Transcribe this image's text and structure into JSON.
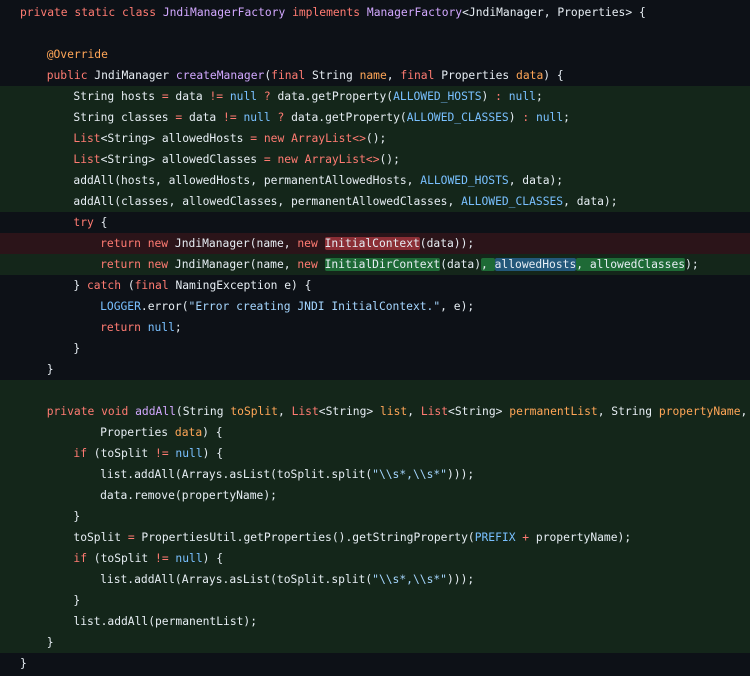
{
  "code": {
    "lines": [
      {
        "indent": 0,
        "bg": "",
        "tokens": [
          {
            "t": "private static class ",
            "c": "kw"
          },
          {
            "t": "JndiManagerFactory ",
            "c": "fn"
          },
          {
            "t": "implements ",
            "c": "kw"
          },
          {
            "t": "ManagerFactory",
            "c": "fn"
          },
          {
            "t": "<JndiManager, Properties> {",
            "c": "id"
          }
        ]
      },
      {
        "indent": 0,
        "bg": "",
        "tokens": []
      },
      {
        "indent": 1,
        "bg": "",
        "tokens": [
          {
            "t": "@Override",
            "c": "ann"
          }
        ]
      },
      {
        "indent": 1,
        "bg": "",
        "tokens": [
          {
            "t": "public ",
            "c": "kw"
          },
          {
            "t": "JndiManager ",
            "c": "id"
          },
          {
            "t": "createManager",
            "c": "fn"
          },
          {
            "t": "(",
            "c": "id"
          },
          {
            "t": "final ",
            "c": "kw"
          },
          {
            "t": "String ",
            "c": "id"
          },
          {
            "t": "name",
            "c": "var"
          },
          {
            "t": ", ",
            "c": "id"
          },
          {
            "t": "final ",
            "c": "kw"
          },
          {
            "t": "Properties ",
            "c": "id"
          },
          {
            "t": "data",
            "c": "var"
          },
          {
            "t": ") {",
            "c": "id"
          }
        ]
      },
      {
        "indent": 2,
        "bg": "add",
        "tokens": [
          {
            "t": "String hosts ",
            "c": "id"
          },
          {
            "t": "= ",
            "c": "kw"
          },
          {
            "t": "data ",
            "c": "id"
          },
          {
            "t": "!= ",
            "c": "kw"
          },
          {
            "t": "null ",
            "c": "const"
          },
          {
            "t": "? ",
            "c": "kw"
          },
          {
            "t": "data.getProperty(",
            "c": "id"
          },
          {
            "t": "ALLOWED_HOSTS",
            "c": "const"
          },
          {
            "t": ") ",
            "c": "id"
          },
          {
            "t": ": ",
            "c": "kw"
          },
          {
            "t": "null",
            "c": "const"
          },
          {
            "t": ";",
            "c": "id"
          }
        ]
      },
      {
        "indent": 2,
        "bg": "add",
        "tokens": [
          {
            "t": "String classes ",
            "c": "id"
          },
          {
            "t": "= ",
            "c": "kw"
          },
          {
            "t": "data ",
            "c": "id"
          },
          {
            "t": "!= ",
            "c": "kw"
          },
          {
            "t": "null ",
            "c": "const"
          },
          {
            "t": "? ",
            "c": "kw"
          },
          {
            "t": "data.getProperty(",
            "c": "id"
          },
          {
            "t": "ALLOWED_CLASSES",
            "c": "const"
          },
          {
            "t": ") ",
            "c": "id"
          },
          {
            "t": ": ",
            "c": "kw"
          },
          {
            "t": "null",
            "c": "const"
          },
          {
            "t": ";",
            "c": "id"
          }
        ]
      },
      {
        "indent": 2,
        "bg": "add",
        "tokens": [
          {
            "t": "List",
            "c": "kw"
          },
          {
            "t": "<String> ",
            "c": "id"
          },
          {
            "t": "allowedHosts ",
            "c": "id"
          },
          {
            "t": "= new ",
            "c": "kw"
          },
          {
            "t": "ArrayList",
            "c": "kw"
          },
          {
            "t": "<>",
            "c": "kw"
          },
          {
            "t": "();",
            "c": "id"
          }
        ]
      },
      {
        "indent": 2,
        "bg": "add",
        "tokens": [
          {
            "t": "List",
            "c": "kw"
          },
          {
            "t": "<String> ",
            "c": "id"
          },
          {
            "t": "allowedClasses ",
            "c": "id"
          },
          {
            "t": "= new ",
            "c": "kw"
          },
          {
            "t": "ArrayList",
            "c": "kw"
          },
          {
            "t": "<>",
            "c": "kw"
          },
          {
            "t": "();",
            "c": "id"
          }
        ]
      },
      {
        "indent": 2,
        "bg": "add",
        "tokens": [
          {
            "t": "addAll(hosts, allowedHosts, permanentAllowedHosts, ",
            "c": "id"
          },
          {
            "t": "ALLOWED_HOSTS",
            "c": "const"
          },
          {
            "t": ", data);",
            "c": "id"
          }
        ]
      },
      {
        "indent": 2,
        "bg": "add",
        "tokens": [
          {
            "t": "addAll(classes, allowedClasses, permanentAllowedClasses, ",
            "c": "id"
          },
          {
            "t": "ALLOWED_CLASSES",
            "c": "const"
          },
          {
            "t": ", data);",
            "c": "id"
          }
        ]
      },
      {
        "indent": 2,
        "bg": "",
        "tokens": [
          {
            "t": "try ",
            "c": "kw"
          },
          {
            "t": "{",
            "c": "id"
          }
        ]
      },
      {
        "indent": 3,
        "bg": "del",
        "tokens": [
          {
            "t": "return new ",
            "c": "kw"
          },
          {
            "t": "JndiManager(name, ",
            "c": "id"
          },
          {
            "t": "new ",
            "c": "kw"
          },
          {
            "t": "InitialContext",
            "c": "id",
            "hl": "del"
          },
          {
            "t": "(data));",
            "c": "id"
          }
        ]
      },
      {
        "indent": 3,
        "bg": "add",
        "tokens": [
          {
            "t": "return new ",
            "c": "kw"
          },
          {
            "t": "JndiManager(name, ",
            "c": "id"
          },
          {
            "t": "new ",
            "c": "kw"
          },
          {
            "t": "InitialDirContext",
            "c": "id",
            "hl": "add"
          },
          {
            "t": "(data)",
            "c": "id"
          },
          {
            "t": ", ",
            "c": "id",
            "hl": "add"
          },
          {
            "t": "allowedHosts",
            "c": "id",
            "hl": "blue"
          },
          {
            "t": ", allowedClasses",
            "c": "id",
            "hl": "add"
          },
          {
            "t": ");",
            "c": "id"
          }
        ]
      },
      {
        "indent": 2,
        "bg": "",
        "tokens": [
          {
            "t": "} ",
            "c": "id"
          },
          {
            "t": "catch ",
            "c": "kw"
          },
          {
            "t": "(",
            "c": "id"
          },
          {
            "t": "final ",
            "c": "kw"
          },
          {
            "t": "NamingException e) {",
            "c": "id"
          }
        ]
      },
      {
        "indent": 3,
        "bg": "",
        "tokens": [
          {
            "t": "LOGGER",
            "c": "const"
          },
          {
            "t": ".error(",
            "c": "id"
          },
          {
            "t": "\"Error creating JNDI InitialContext.\"",
            "c": "str"
          },
          {
            "t": ", e);",
            "c": "id"
          }
        ]
      },
      {
        "indent": 3,
        "bg": "",
        "tokens": [
          {
            "t": "return ",
            "c": "kw"
          },
          {
            "t": "null",
            "c": "const"
          },
          {
            "t": ";",
            "c": "id"
          }
        ]
      },
      {
        "indent": 2,
        "bg": "",
        "tokens": [
          {
            "t": "}",
            "c": "id"
          }
        ]
      },
      {
        "indent": 1,
        "bg": "",
        "tokens": [
          {
            "t": "}",
            "c": "id"
          }
        ]
      },
      {
        "indent": 0,
        "bg": "add",
        "tokens": []
      },
      {
        "indent": 1,
        "bg": "add",
        "tokens": [
          {
            "t": "private void ",
            "c": "kw"
          },
          {
            "t": "addAll",
            "c": "fn"
          },
          {
            "t": "(String ",
            "c": "id"
          },
          {
            "t": "toSplit",
            "c": "var"
          },
          {
            "t": ", ",
            "c": "id"
          },
          {
            "t": "List",
            "c": "kw"
          },
          {
            "t": "<String> ",
            "c": "id"
          },
          {
            "t": "list",
            "c": "var"
          },
          {
            "t": ", ",
            "c": "id"
          },
          {
            "t": "List",
            "c": "kw"
          },
          {
            "t": "<String> ",
            "c": "id"
          },
          {
            "t": "permanentList",
            "c": "var"
          },
          {
            "t": ", String ",
            "c": "id"
          },
          {
            "t": "propertyName",
            "c": "var"
          },
          {
            "t": ",",
            "c": "id"
          }
        ]
      },
      {
        "indent": 3,
        "bg": "add",
        "tokens": [
          {
            "t": "Properties ",
            "c": "id"
          },
          {
            "t": "data",
            "c": "var"
          },
          {
            "t": ") {",
            "c": "id"
          }
        ]
      },
      {
        "indent": 2,
        "bg": "add",
        "tokens": [
          {
            "t": "if ",
            "c": "kw"
          },
          {
            "t": "(toSplit ",
            "c": "id"
          },
          {
            "t": "!= ",
            "c": "kw"
          },
          {
            "t": "null",
            "c": "const"
          },
          {
            "t": ") {",
            "c": "id"
          }
        ]
      },
      {
        "indent": 3,
        "bg": "add",
        "tokens": [
          {
            "t": "list.addAll(Arrays.asList(toSplit.split(",
            "c": "id"
          },
          {
            "t": "\"\\\\s*,\\\\s*\"",
            "c": "str"
          },
          {
            "t": ")));",
            "c": "id"
          }
        ]
      },
      {
        "indent": 3,
        "bg": "add",
        "tokens": [
          {
            "t": "data.remove(propertyName);",
            "c": "id"
          }
        ]
      },
      {
        "indent": 2,
        "bg": "add",
        "tokens": [
          {
            "t": "}",
            "c": "id"
          }
        ]
      },
      {
        "indent": 2,
        "bg": "add",
        "tokens": [
          {
            "t": "toSplit ",
            "c": "id"
          },
          {
            "t": "= ",
            "c": "kw"
          },
          {
            "t": "PropertiesUtil.getProperties().getStringProperty(",
            "c": "id"
          },
          {
            "t": "PREFIX ",
            "c": "const"
          },
          {
            "t": "+ ",
            "c": "kw"
          },
          {
            "t": "propertyName);",
            "c": "id"
          }
        ]
      },
      {
        "indent": 2,
        "bg": "add",
        "tokens": [
          {
            "t": "if ",
            "c": "kw"
          },
          {
            "t": "(toSplit ",
            "c": "id"
          },
          {
            "t": "!= ",
            "c": "kw"
          },
          {
            "t": "null",
            "c": "const"
          },
          {
            "t": ") {",
            "c": "id"
          }
        ]
      },
      {
        "indent": 3,
        "bg": "add",
        "tokens": [
          {
            "t": "list.addAll(Arrays.asList(toSplit.split(",
            "c": "id"
          },
          {
            "t": "\"\\\\s*,\\\\s*\"",
            "c": "str"
          },
          {
            "t": ")));",
            "c": "id"
          }
        ]
      },
      {
        "indent": 2,
        "bg": "add",
        "tokens": [
          {
            "t": "}",
            "c": "id"
          }
        ]
      },
      {
        "indent": 2,
        "bg": "add",
        "tokens": [
          {
            "t": "list.addAll(permanentList);",
            "c": "id"
          }
        ]
      },
      {
        "indent": 1,
        "bg": "add",
        "tokens": [
          {
            "t": "}",
            "c": "id"
          }
        ]
      },
      {
        "indent": 0,
        "bg": "",
        "tokens": [
          {
            "t": "}",
            "c": "id"
          }
        ]
      }
    ]
  },
  "colors": {
    "background": "#0d1117",
    "added_line": "#14261a",
    "removed_line": "#2b1419",
    "keyword": "#ff7b72",
    "function": "#d2a8ff",
    "constant": "#79c0ff",
    "string": "#a5d6ff",
    "parameter": "#ffa657"
  }
}
